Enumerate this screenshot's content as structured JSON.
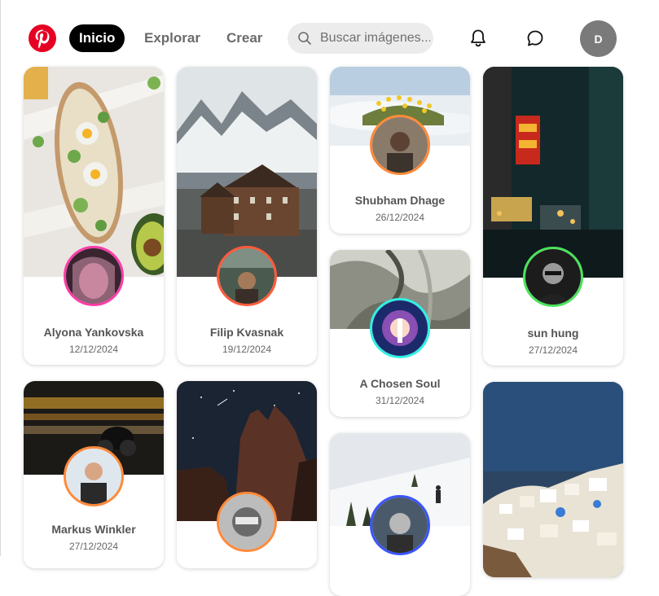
{
  "nav": {
    "home_label": "Inicio",
    "explore_label": "Explorar",
    "create_label": "Crear"
  },
  "search": {
    "placeholder": "Buscar imágenes..."
  },
  "user": {
    "initial": "D"
  },
  "colors": {
    "brand": "#e60023",
    "active_pill": "#000000"
  },
  "icons": [
    "pinterest-logo-icon",
    "search-icon",
    "bell-icon",
    "chat-bubble-icon"
  ],
  "pins": [
    {
      "name": "Alyona Yankovska",
      "date": "12/12/2024",
      "ring_color": "#ff3ca8"
    },
    {
      "name": "Filip Kvasnak",
      "date": "19/12/2024",
      "ring_color": "#ff5b3a"
    },
    {
      "name": "Shubham Dhage",
      "date": "26/12/2024",
      "ring_color": "#ff8a3a"
    },
    {
      "name": "sun hung",
      "date": "27/12/2024",
      "ring_color": "#4be35a"
    },
    {
      "name": "A Chosen Soul",
      "date": "31/12/2024",
      "ring_color": "#2ff0e4"
    },
    {
      "name": "Markus Winkler",
      "date": "27/12/2024",
      "ring_color": "#ff8a3a"
    },
    {
      "name": "",
      "date": "",
      "ring_color": "#ff8a3a"
    },
    {
      "name": "",
      "date": "",
      "ring_color": "#3a55ff"
    },
    {
      "name": "",
      "date": "",
      "ring_color": ""
    }
  ]
}
